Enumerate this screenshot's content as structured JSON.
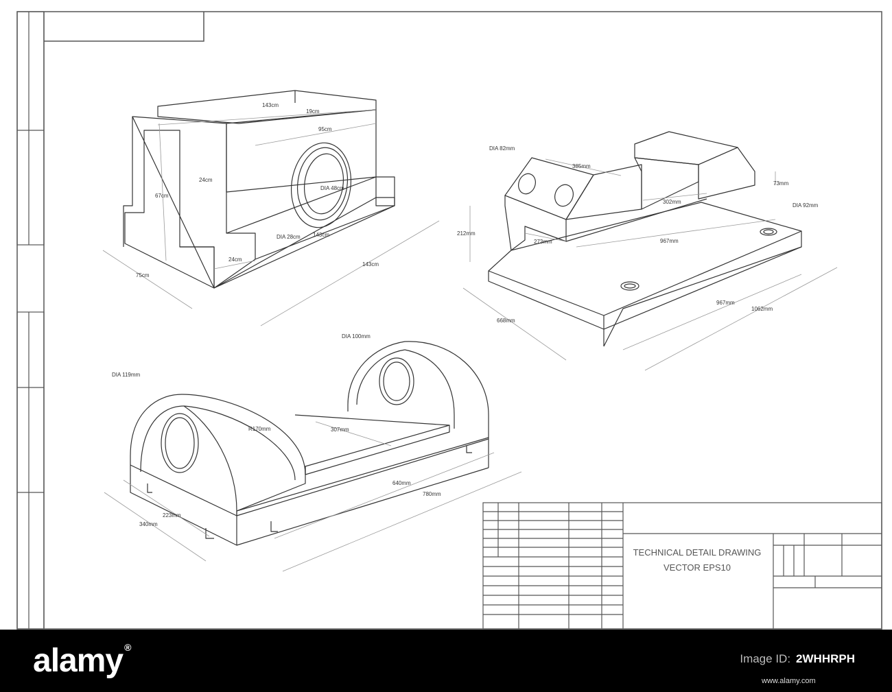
{
  "drawing": {
    "title_line1": "TECHNICAL DETAIL DRAWING",
    "title_line2": "VECTOR  EPS10",
    "bracket_dims": {
      "top1": "143cm",
      "top2": "19cm",
      "inner_len": "95cm",
      "left_w": "24cm",
      "height": "67cm",
      "bore": "DIA 48cm",
      "ring": "DIA 28cm",
      "base_w": "143cm",
      "step": "24cm",
      "depth": "75cm",
      "length": "143cm"
    },
    "vise_dims": {
      "dia_left": "DIA 82mm",
      "top_len": "385mm",
      "jaw_gap": "302mm",
      "jaw_h": "73mm",
      "dia_right": "DIA 92mm",
      "height": "212mm",
      "slot": "273mm",
      "inner_len": "967mm",
      "depth": "668mm",
      "base_len": "967mm",
      "total_len": "1062mm"
    },
    "cradle_dims": {
      "dia_right": "DIA 100mm",
      "dia_left": "DIA 119mm",
      "radius": "R170mm",
      "bed": "307mm",
      "len": "640mm",
      "total_len": "780mm",
      "width": "223mm",
      "depth": "340mm"
    }
  },
  "footer": {
    "brand": "alamy",
    "reg": "®",
    "stock_label": "Image ID:",
    "stock_id": "2WHHRPH",
    "url": "www.alamy.com"
  }
}
